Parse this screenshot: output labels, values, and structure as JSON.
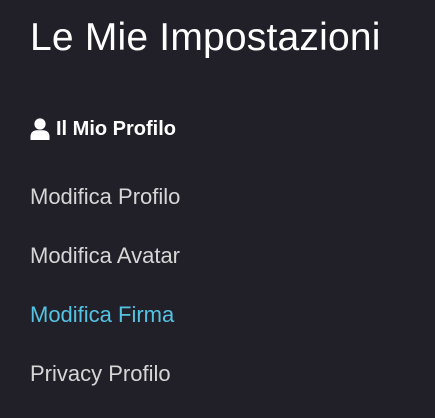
{
  "page": {
    "title": "Le Mie Impostazioni"
  },
  "section": {
    "icon": "user-icon",
    "label": "Il Mio Profilo"
  },
  "nav": {
    "items": [
      {
        "label": "Modifica Profilo",
        "active": false
      },
      {
        "label": "Modifica Avatar",
        "active": false
      },
      {
        "label": "Modifica Firma",
        "active": true
      },
      {
        "label": "Privacy Profilo",
        "active": false
      }
    ]
  },
  "colors": {
    "background": "#212029",
    "text": "#d6d6d6",
    "heading": "#ffffff",
    "active": "#54c3e3"
  }
}
